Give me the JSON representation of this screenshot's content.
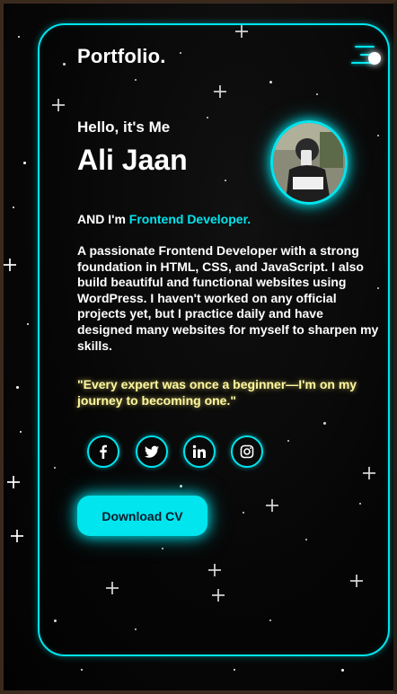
{
  "header": {
    "logo": "Portfolio."
  },
  "hero": {
    "greeting": "Hello, it's Me",
    "name": "Ali Jaan",
    "role_prefix": "AND I'm",
    "role": "Frontend Developer.",
    "bio": "A passionate Frontend Developer with a strong foundation in HTML, CSS, and JavaScript. I also build beautiful and functional websites using WordPress. I haven't worked on any official projects yet, but I practice daily and have designed many websites for myself to sharpen my skills.",
    "quote": "\"Every expert was once a beginner—I'm on my journey to becoming one.\""
  },
  "social": [
    {
      "icon": "facebook-icon"
    },
    {
      "icon": "twitter-icon"
    },
    {
      "icon": "linkedin-icon"
    },
    {
      "icon": "instagram-icon"
    }
  ],
  "cta": {
    "download_label": "Download CV"
  },
  "colors": {
    "accent": "#00e5ee",
    "quote": "#fff8a0",
    "background": "#050505",
    "button_text": "#0b1a2a"
  }
}
